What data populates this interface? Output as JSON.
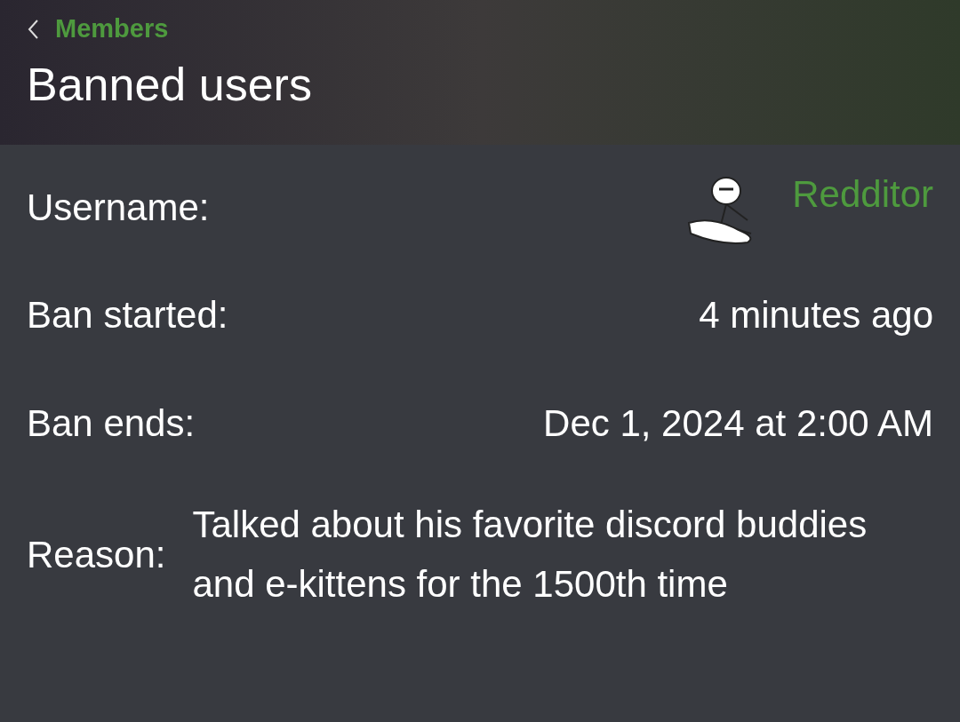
{
  "header": {
    "back_label": "Members",
    "title": "Banned users"
  },
  "details": [
    {
      "kind": "user",
      "label": "Username:",
      "value": "Redditor"
    },
    {
      "kind": "text",
      "label": "Ban started:",
      "value": "4 minutes ago"
    },
    {
      "kind": "text",
      "label": "Ban ends:",
      "value": "Dec 1, 2024 at 2:00 AM"
    },
    {
      "kind": "reason",
      "label": "Reason:",
      "value": "Talked about his favorite discord buddies and e-kittens for the 1500th time"
    }
  ]
}
